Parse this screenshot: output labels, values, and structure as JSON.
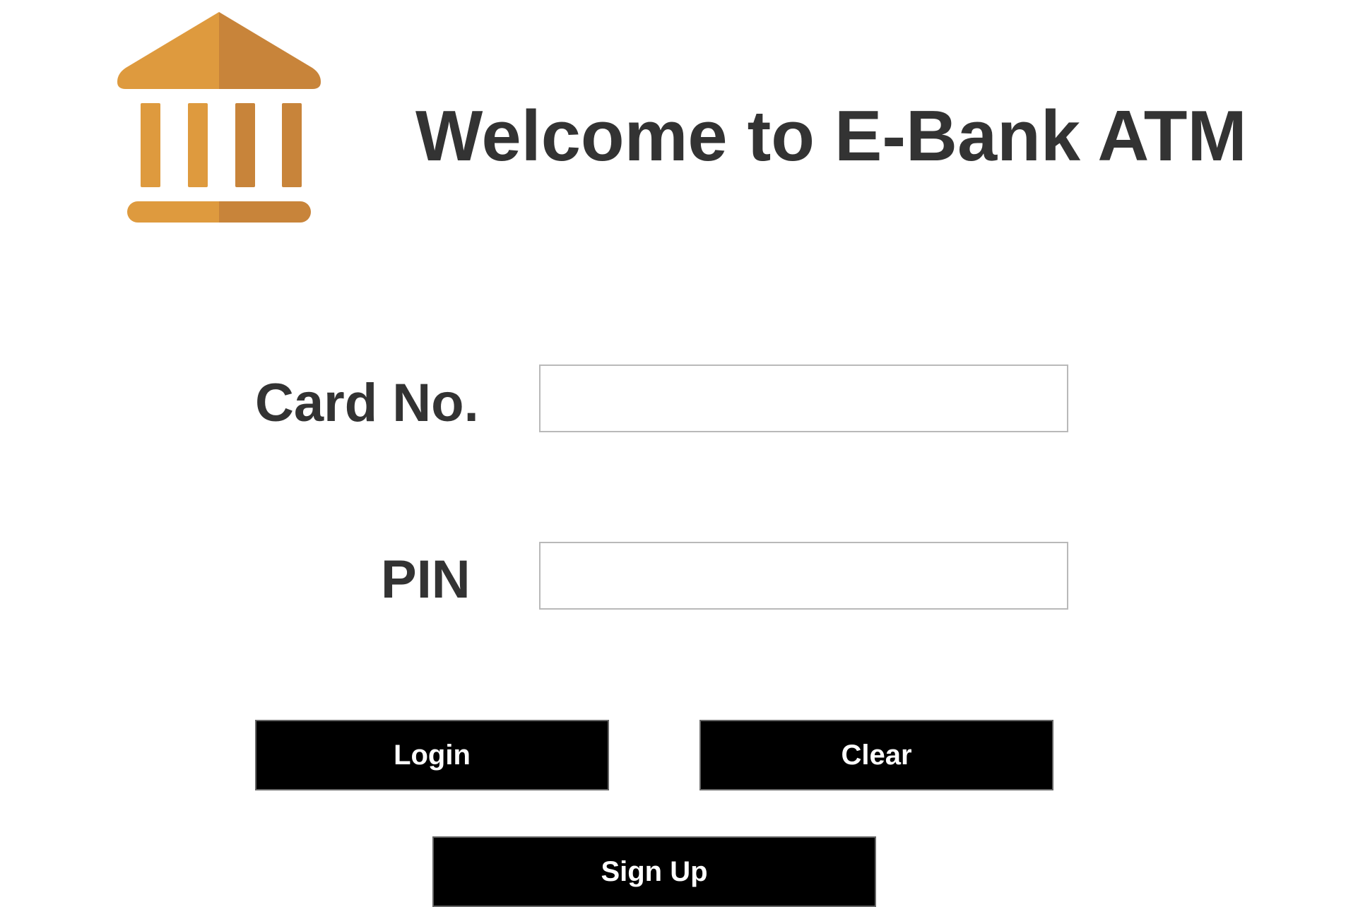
{
  "header": {
    "title": "Welcome to E-Bank ATM",
    "logo_icon": "bank-building-icon"
  },
  "form": {
    "card_label": "Card No.",
    "card_value": "",
    "pin_label": "PIN",
    "pin_value": ""
  },
  "buttons": {
    "login_label": "Login",
    "clear_label": "Clear",
    "signup_label": "Sign Up"
  },
  "colors": {
    "logo_light": "#DE9A3E",
    "logo_dark": "#C8843A",
    "text": "#333333",
    "button_bg": "#000000",
    "button_text": "#FFFFFF"
  }
}
